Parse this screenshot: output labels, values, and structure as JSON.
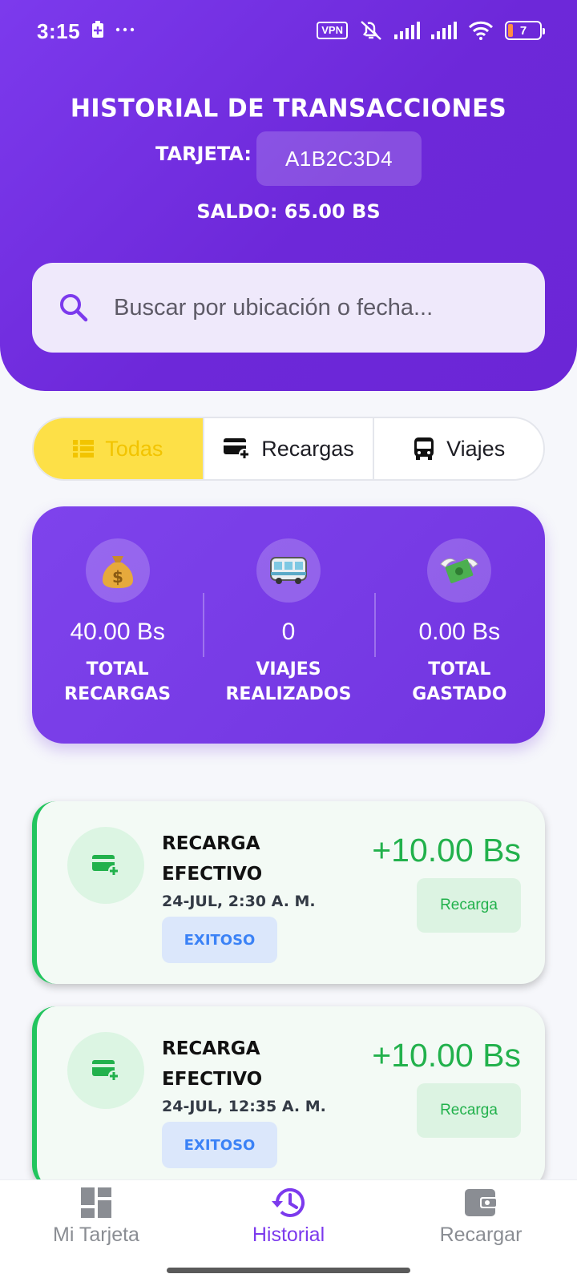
{
  "status_bar": {
    "time": "3:15",
    "vpn": "VPN",
    "battery": "7",
    "icons": [
      "battery-saver-icon",
      "more-dots-icon",
      "vpn-icon",
      "mute-icon",
      "signal-icon",
      "signal-icon",
      "wifi-icon",
      "battery-icon"
    ]
  },
  "header": {
    "title": "HISTORIAL DE TRANSACCIONES",
    "card_label": "TARJETA:",
    "card_code": "A1B2C3D4",
    "saldo": "SALDO: 65.00 BS"
  },
  "search": {
    "placeholder": "Buscar por ubicación o fecha..."
  },
  "filters": {
    "tabs": [
      {
        "label": "Todas",
        "icon": "list-icon",
        "active": true
      },
      {
        "label": "Recargas",
        "icon": "card-add-icon",
        "active": false
      },
      {
        "label": "Viajes",
        "icon": "bus-icon",
        "active": false
      }
    ]
  },
  "stats": [
    {
      "icon": "money-bag-icon",
      "value": "40.00 Bs",
      "label": "TOTAL RECARGAS"
    },
    {
      "icon": "bus-emoji-icon",
      "value": "0",
      "label": "VIAJES REALIZADOS"
    },
    {
      "icon": "money-wings-icon",
      "value": "0.00 Bs",
      "label": "TOTAL GASTADO"
    }
  ],
  "transactions": [
    {
      "title": "RECARGA EFECTIVO",
      "date": "24-JUL, 2:30 A. M.",
      "status": "EXITOSO",
      "amount": "+10.00 Bs",
      "type": "Recarga"
    },
    {
      "title": "RECARGA EFECTIVO",
      "date": "24-JUL, 12:35 A. M.",
      "status": "EXITOSO",
      "amount": "+10.00 Bs",
      "type": "Recarga"
    }
  ],
  "bottom_nav": [
    {
      "label": "Mi Tarjeta",
      "icon": "dashboard-icon",
      "active": false
    },
    {
      "label": "Historial",
      "icon": "history-icon",
      "active": true
    },
    {
      "label": "Recargar",
      "icon": "wallet-icon",
      "active": false
    }
  ],
  "colors": {
    "primary": "#7c3aed",
    "accent_yellow": "#fde047",
    "success": "#22c55e",
    "status_blue": "#3b82f6"
  }
}
